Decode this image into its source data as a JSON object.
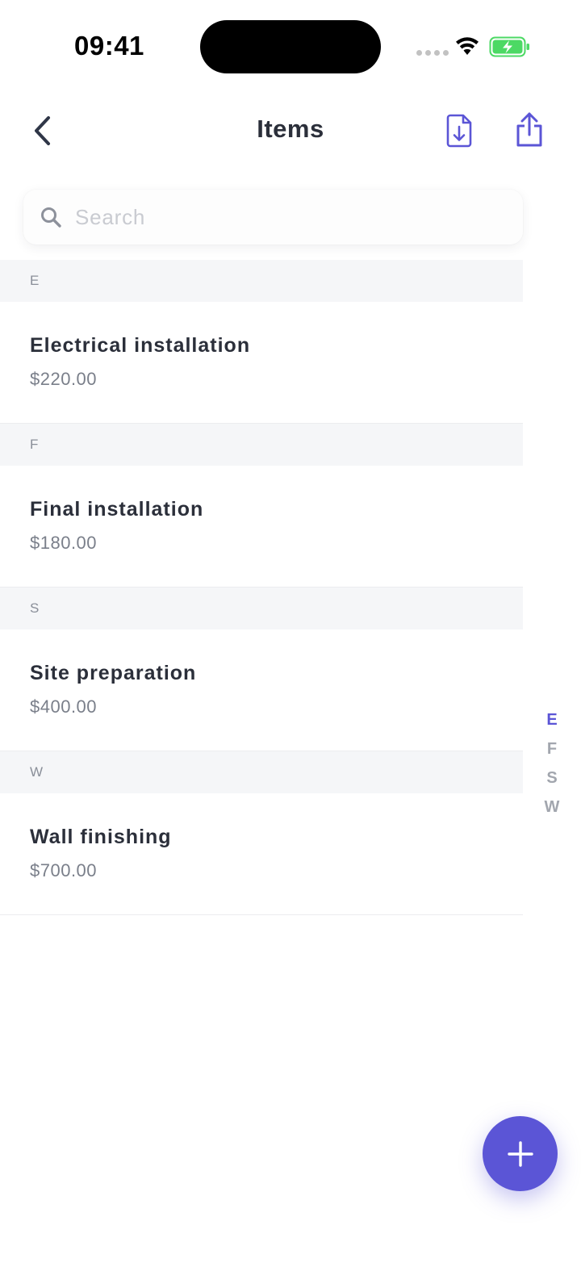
{
  "status_bar": {
    "time": "09:41"
  },
  "nav": {
    "title": "Items",
    "back_icon": "chevron-left-icon",
    "export_icon": "file-download-icon",
    "share_icon": "share-icon"
  },
  "search": {
    "placeholder": "Search",
    "value": ""
  },
  "sections": [
    {
      "letter": "E",
      "items": [
        {
          "name": "Electrical installation",
          "price": "$220.00"
        }
      ]
    },
    {
      "letter": "F",
      "items": [
        {
          "name": "Final installation",
          "price": "$180.00"
        }
      ]
    },
    {
      "letter": "S",
      "items": [
        {
          "name": "Site preparation",
          "price": "$400.00"
        }
      ]
    },
    {
      "letter": "W",
      "items": [
        {
          "name": "Wall finishing",
          "price": "$700.00"
        }
      ]
    }
  ],
  "index_bar": {
    "letters": [
      "E",
      "F",
      "S",
      "W"
    ],
    "active": "E"
  },
  "fab": {
    "icon": "plus-icon"
  },
  "colors": {
    "accent": "#5b55d6",
    "text_primary": "#2b2f3a",
    "text_secondary": "#7a7f8a",
    "section_bg": "#f5f6f8",
    "battery_green": "#4cd964"
  }
}
